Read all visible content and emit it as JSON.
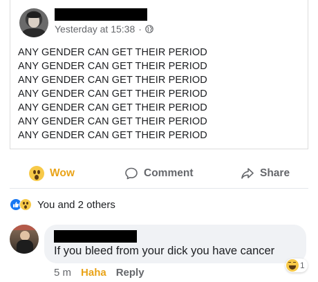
{
  "post": {
    "timestamp": "Yesterday at 15:38",
    "separator": "·",
    "privacy_icon": "globe-icon",
    "lines": [
      "ANY GENDER CAN GET THEIR PERIOD",
      "ANY GENDER CAN GET THEIR PERIOD",
      "ANY GENDER CAN GET THEIR PERIOD",
      "ANY GENDER CAN GET THEIR PERIOD",
      "ANY GENDER CAN GET THEIR PERIOD",
      "ANY GENDER CAN GET THEIR PERIOD",
      "ANY GENDER CAN GET THEIR PERIOD"
    ]
  },
  "actions": {
    "wow_label": "Wow",
    "comment_label": "Comment",
    "share_label": "Share"
  },
  "reactions": {
    "summary": "You and 2 others"
  },
  "comment": {
    "text": "If you bleed from your dick you have cancer",
    "time": "5 m",
    "haha_label": "Haha",
    "reply_label": "Reply",
    "reaction_count": "1"
  },
  "colors": {
    "wow_accent": "#e9a318",
    "like_blue": "#1877f2",
    "muted_text": "#65676b",
    "bubble_bg": "#f0f2f5"
  }
}
